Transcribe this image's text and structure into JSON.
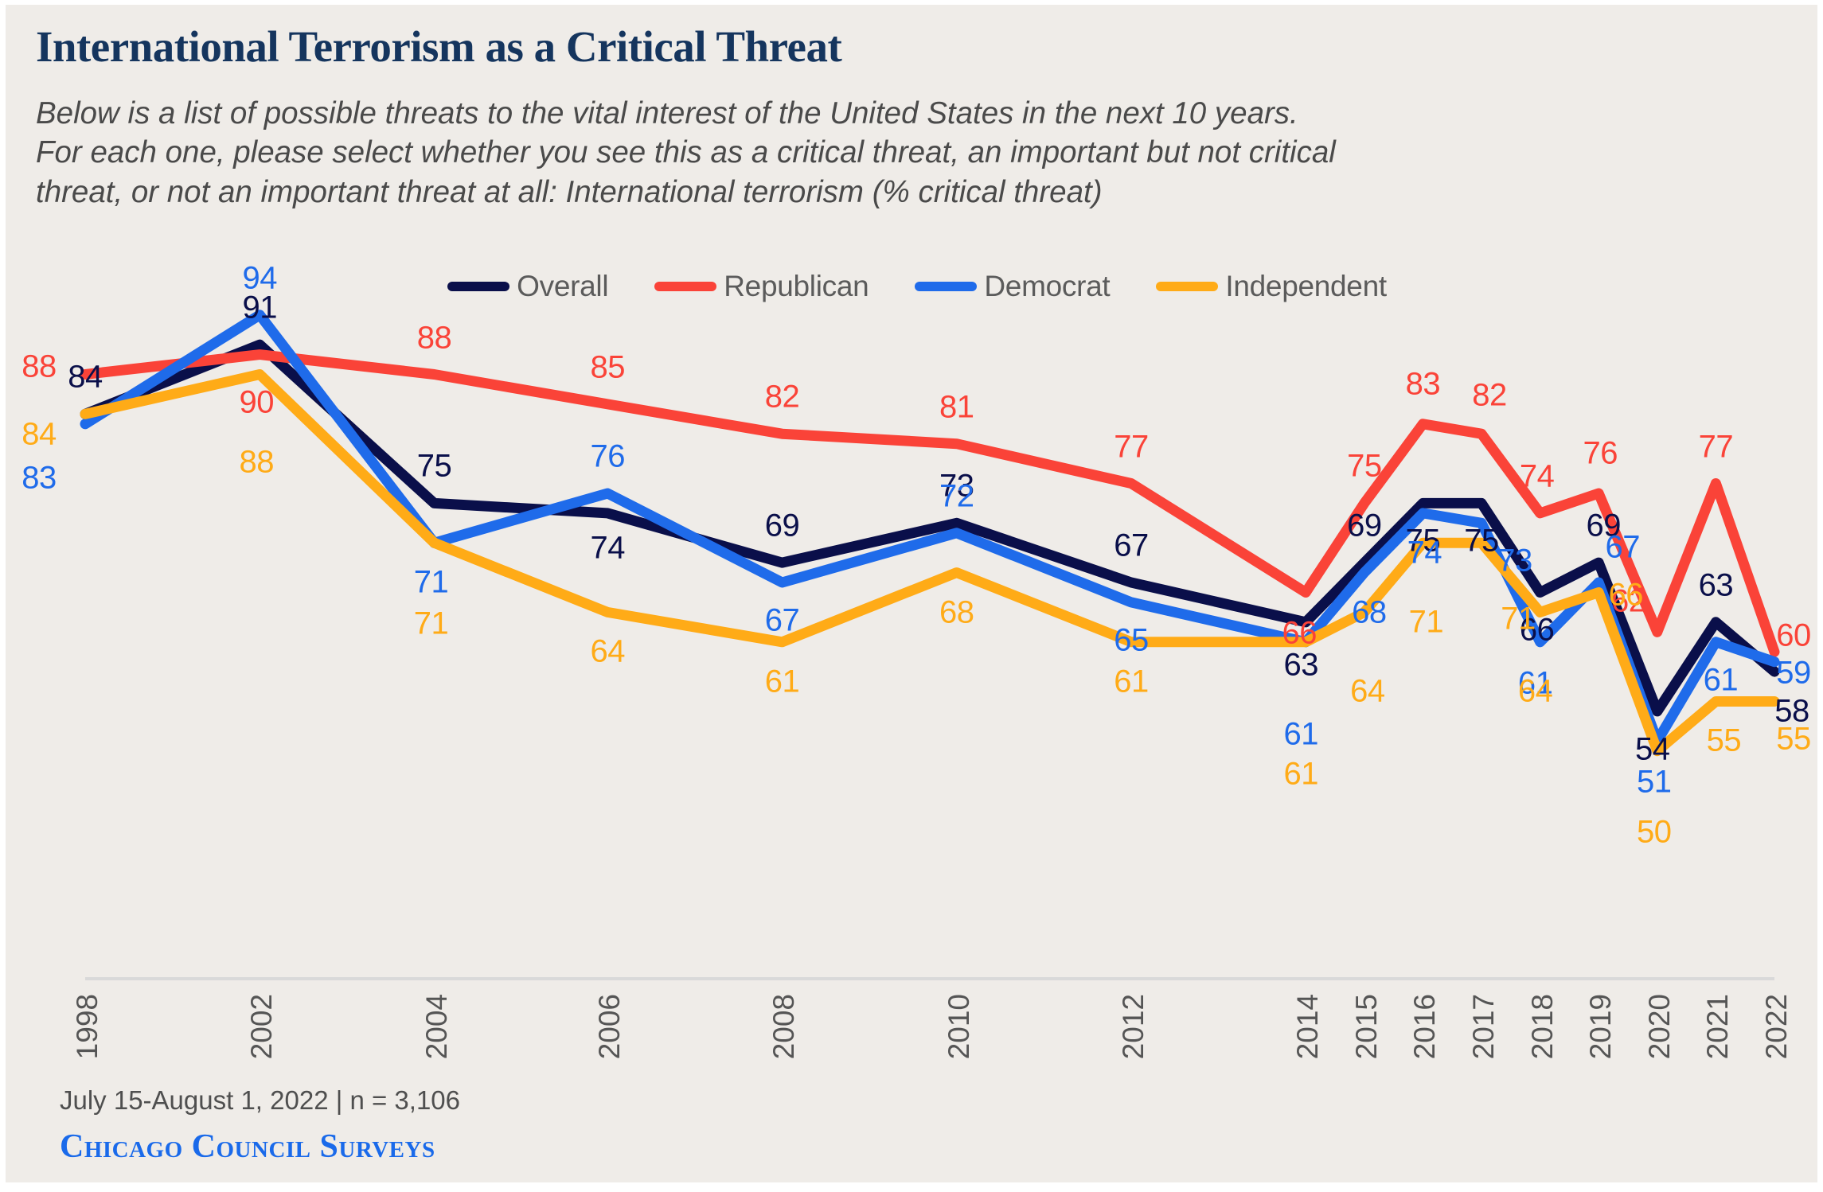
{
  "title": "International Terrorism as a Critical Threat",
  "subtitle_lines": [
    "Below is a list of possible threats to the vital interest of the United States in the next 10 years.",
    "For each one, please select whether you see this as a critical threat, an important but not critical",
    "threat, or not an important threat at all: International terrorism (% critical threat)"
  ],
  "legend": [
    {
      "label": "Overall",
      "color": "#0a0f4a"
    },
    {
      "label": "Republican",
      "color": "#fa4338"
    },
    {
      "label": "Democrat",
      "color": "#1f6bea"
    },
    {
      "label": "Independent",
      "color": "#ffab17"
    }
  ],
  "footer": {
    "note": "July 15-August 1, 2022 | n = 3,106",
    "brand": "Chicago Council Surveys",
    "brand_color": "#1a6aea"
  },
  "colors": {
    "background": "#efece8",
    "title": "#15355e",
    "subtitle": "#4a4a4a",
    "axis_rule": "#d9d9d9",
    "tick": "#555555"
  },
  "chart_data": {
    "type": "line",
    "title": "International Terrorism as a Critical Threat",
    "subtitle": "Below is a list of possible threats to the vital interest of the United States in the next 10 years. For each one, please select whether you see this as a critical threat, an important but not critical threat, or not an important threat at all: International terrorism (% critical threat)",
    "xlabel": "",
    "ylabel": "% critical threat",
    "ylim": [
      45,
      98
    ],
    "grid": false,
    "legend_position": "top-center",
    "categories": [
      "1998",
      "2002",
      "2004",
      "2006",
      "2008",
      "2010",
      "2012",
      "2014",
      "2015",
      "2016",
      "2017",
      "2018",
      "2019",
      "2020",
      "2021",
      "2022"
    ],
    "series": [
      {
        "name": "Overall",
        "color": "#0a0f4a",
        "values": [
          84,
          91,
          75,
          74,
          69,
          73,
          67,
          63,
          69,
          75,
          75,
          66,
          69,
          54,
          63,
          58
        ]
      },
      {
        "name": "Republican",
        "color": "#fa4338",
        "values": [
          88,
          90,
          88,
          85,
          82,
          81,
          77,
          66,
          75,
          83,
          82,
          74,
          76,
          62,
          77,
          60
        ]
      },
      {
        "name": "Democrat",
        "color": "#1f6bea",
        "values": [
          83,
          94,
          71,
          76,
          67,
          72,
          65,
          61,
          68,
          74,
          73,
          61,
          67,
          51,
          61,
          59
        ]
      },
      {
        "name": "Independent",
        "color": "#ffab17",
        "values": [
          84,
          88,
          71,
          64,
          61,
          68,
          61,
          61,
          64,
          71,
          71,
          64,
          66,
          50,
          55,
          55
        ]
      }
    ]
  },
  "label_offsets": {
    "Overall": [
      [
        0,
        -46
      ],
      [
        0,
        -46
      ],
      [
        0,
        -46
      ],
      [
        0,
        44
      ],
      [
        0,
        -46
      ],
      [
        0,
        -46
      ],
      [
        0,
        -46
      ],
      [
        -6,
        54
      ],
      [
        0,
        -46
      ],
      [
        0,
        48
      ],
      [
        0,
        48
      ],
      [
        -4,
        48
      ],
      [
        6,
        -46
      ],
      [
        -6,
        48
      ],
      [
        0,
        -46
      ],
      [
        22,
        50
      ]
    ],
    "Republican": [
      [
        -58,
        -10
      ],
      [
        -4,
        60
      ],
      [
        0,
        -46
      ],
      [
        0,
        -46
      ],
      [
        0,
        -46
      ],
      [
        0,
        -46
      ],
      [
        0,
        -46
      ],
      [
        -8,
        52
      ],
      [
        0,
        -46
      ],
      [
        0,
        -50
      ],
      [
        10,
        -48
      ],
      [
        -4,
        -46
      ],
      [
        2,
        -50
      ],
      [
        -36,
        -38
      ],
      [
        0,
        -46
      ],
      [
        24,
        -20
      ]
    ],
    "Democrat": [
      [
        -58,
        68
      ],
      [
        0,
        -46
      ],
      [
        -4,
        50
      ],
      [
        0,
        -46
      ],
      [
        0,
        48
      ],
      [
        0,
        -46
      ],
      [
        0,
        48
      ],
      [
        -6,
        116
      ],
      [
        6,
        50
      ],
      [
        2,
        50
      ],
      [
        42,
        48
      ],
      [
        -6,
        52
      ],
      [
        30,
        -44
      ],
      [
        -4,
        52
      ],
      [
        6,
        48
      ],
      [
        24,
        14
      ]
    ],
    "Independent": [
      [
        -58,
        26
      ],
      [
        -4,
        110
      ],
      [
        -4,
        102
      ],
      [
        0,
        50
      ],
      [
        0,
        50
      ],
      [
        0,
        50
      ],
      [
        0,
        50
      ],
      [
        -6,
        166
      ],
      [
        4,
        100
      ],
      [
        4,
        100
      ],
      [
        46,
        96
      ],
      [
        -6,
        100
      ],
      [
        34,
        4
      ],
      [
        -4,
        102
      ],
      [
        10,
        50
      ],
      [
        24,
        48
      ]
    ]
  }
}
